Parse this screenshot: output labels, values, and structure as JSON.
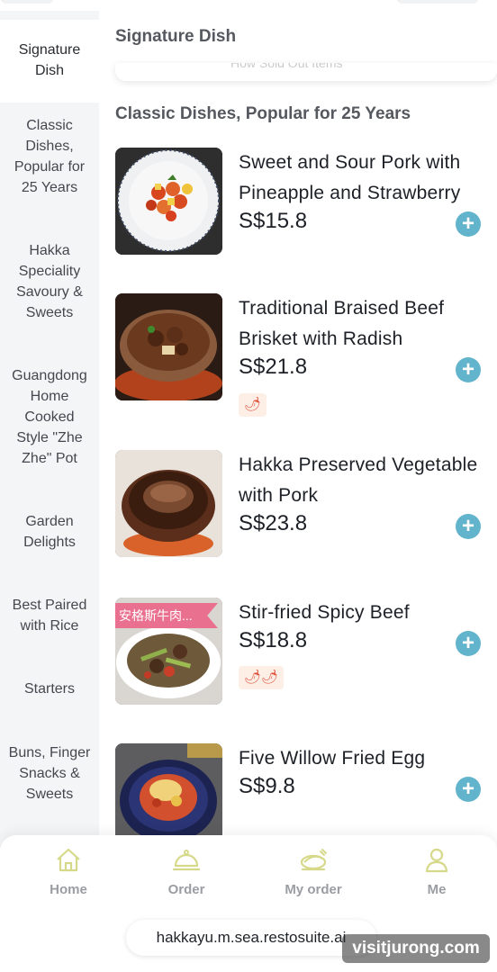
{
  "sidebar": {
    "items": [
      {
        "label": "Signature Dish"
      },
      {
        "label": "Classic Dishes, Popular for 25 Years"
      },
      {
        "label": "Hakka Speciality Savoury & Sweets"
      },
      {
        "label": "Guangdong Home Cooked Style \"Zhe Zhe\" Pot"
      },
      {
        "label": "Garden Delights"
      },
      {
        "label": "Best Paired with Rice"
      },
      {
        "label": "Starters"
      },
      {
        "label": "Buns, Finger Snacks & Sweets"
      }
    ]
  },
  "main": {
    "signature_title": "Signature Dish",
    "signature_partial": "How Sold Out Items",
    "classic_title": "Classic Dishes, Popular for 25 Years",
    "dishes": [
      {
        "name": "Sweet and Sour Pork with Pineapple and Strawberry",
        "price": "S$15.8"
      },
      {
        "name": "Traditional Braised Beef Brisket with Radish",
        "price": "S$21.8",
        "spice": "🌶"
      },
      {
        "name": "Hakka Preserved Vegetable with Pork",
        "price": "S$23.8"
      },
      {
        "name": "Stir-fried Spicy Beef",
        "price": "S$18.8",
        "spice": "🌶🌶",
        "tag": "安格斯牛肉..."
      },
      {
        "name": "Five Willow Fried Egg",
        "price": "S$9.8"
      }
    ],
    "add_label": "+"
  },
  "nav": {
    "items": [
      {
        "label": "Home",
        "icon": "home-icon"
      },
      {
        "label": "Order",
        "icon": "cloche-icon"
      },
      {
        "label": "My order",
        "icon": "dish-icon"
      },
      {
        "label": "Me",
        "icon": "person-icon"
      }
    ]
  },
  "url": "hakkayu.m.sea.restosuite.ai",
  "watermark": "visitjurong.com",
  "colors": {
    "accent": "#62b3cc",
    "nav_icon": "#d6d98a",
    "tag": "#e9718f"
  }
}
